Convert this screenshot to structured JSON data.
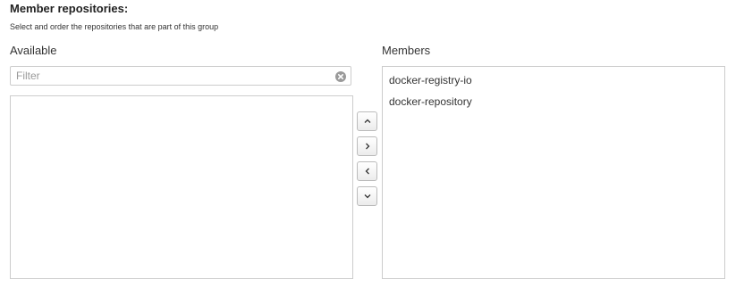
{
  "section": {
    "title": "Member repositories:",
    "subtitle": "Select and order the repositories that are part of this group"
  },
  "available": {
    "label": "Available",
    "filter_placeholder": "Filter",
    "filter_value": "",
    "items": []
  },
  "members": {
    "label": "Members",
    "items": [
      "docker-registry-io",
      "docker-repository"
    ]
  },
  "controls": {
    "move_up": "chevron-up-icon",
    "add": "chevron-right-icon",
    "remove": "chevron-left-icon",
    "move_down": "chevron-down-icon"
  }
}
